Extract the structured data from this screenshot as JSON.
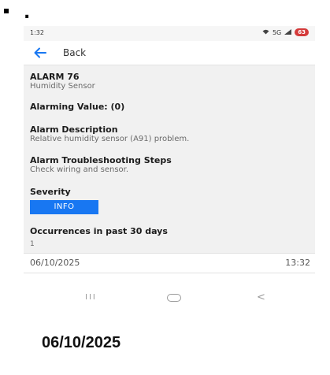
{
  "outer": {
    "dot": "."
  },
  "statusbar": {
    "time": "1:32",
    "signal_text": "5G",
    "battery": "63"
  },
  "appbar": {
    "back_label": "Back"
  },
  "alarm": {
    "title": "ALARM 76",
    "sensor": "Humidity Sensor",
    "alarming_value": "Alarming Value: (0)",
    "description_heading": "Alarm Description",
    "description": "Relative humidity sensor (A91) problem.",
    "troubleshooting_heading": "Alarm Troubleshooting Steps",
    "troubleshooting": "Check wiring and sensor.",
    "severity_heading": "Severity",
    "severity": "INFO",
    "severity_color": "#1877f2",
    "occurrences_heading": "Occurrences in past 30 days",
    "occurrences": "1"
  },
  "datebar": {
    "date": "06/10/2025",
    "time": "13:32"
  },
  "navbar": {
    "recents": "III",
    "back": "<"
  },
  "caption": {
    "date": "06/10/2025"
  }
}
